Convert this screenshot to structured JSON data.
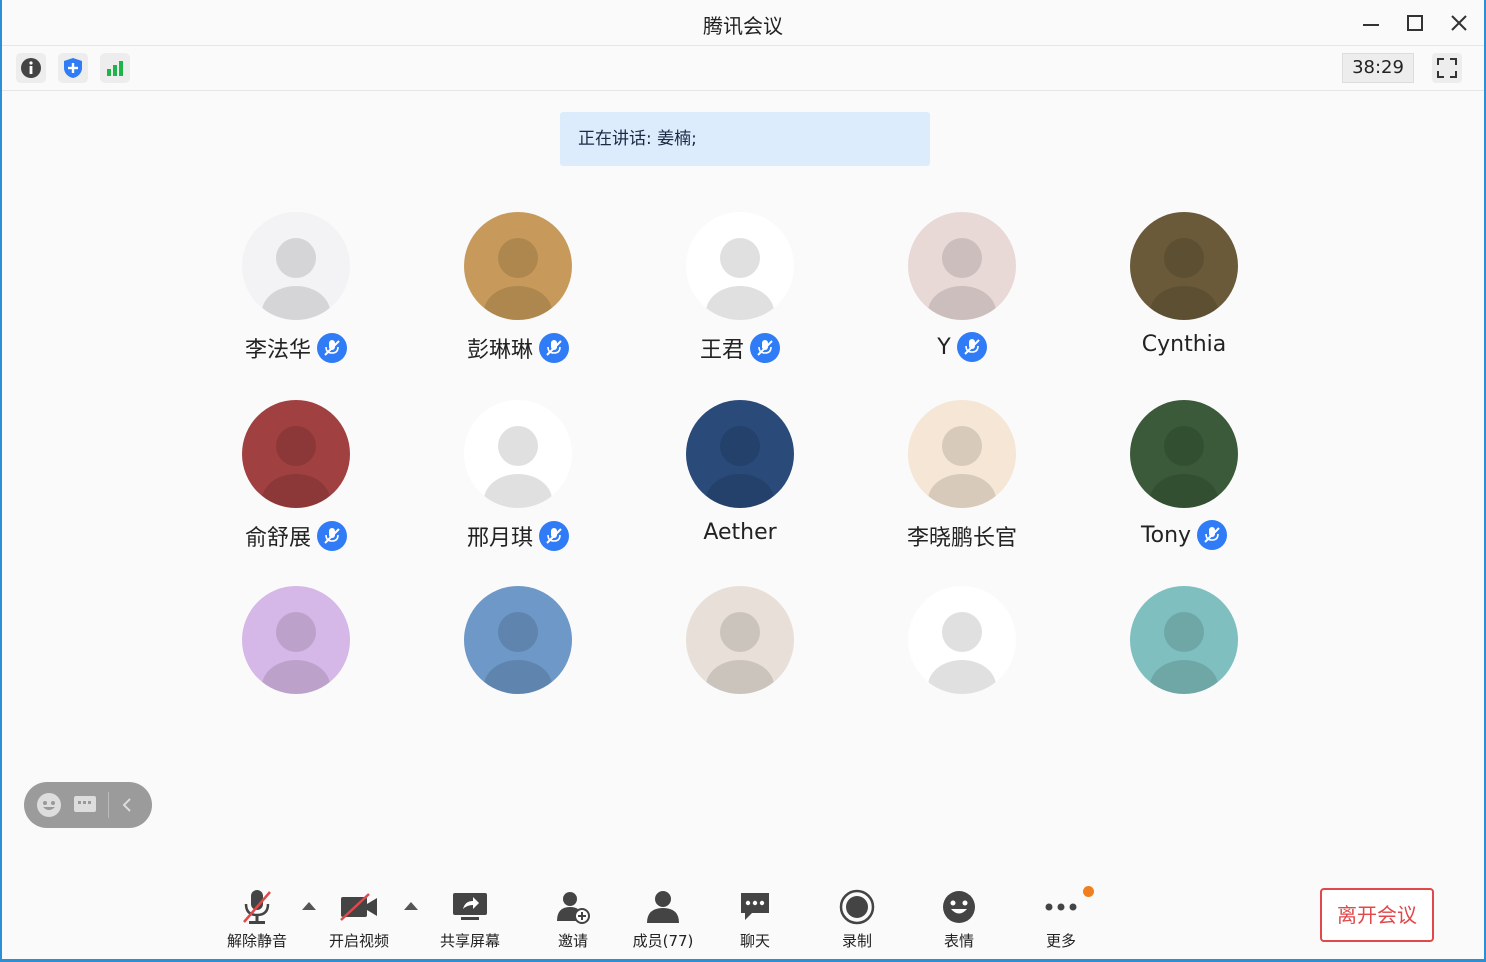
{
  "window": {
    "title": "腾讯会议"
  },
  "toolbar": {
    "timer": "38:29",
    "icons": [
      "info-icon",
      "shield-icon",
      "signal-icon"
    ]
  },
  "speaking": {
    "text": "正在讲话: 姜楠;"
  },
  "participants": [
    {
      "name": "李法华",
      "muted": true,
      "avatar_color": "#f3f3f5"
    },
    {
      "name": "彭琳琳",
      "muted": true,
      "avatar_color": "#c79a5b"
    },
    {
      "name": "王君",
      "muted": true,
      "avatar_color": "#ffffff"
    },
    {
      "name": "Y",
      "muted": true,
      "avatar_color": "#e9d9d6"
    },
    {
      "name": "Cynthia",
      "muted": false,
      "avatar_color": "#6a5a3a"
    },
    {
      "name": "俞舒展",
      "muted": true,
      "avatar_color": "#a04040"
    },
    {
      "name": "邢月琪",
      "muted": true,
      "avatar_color": "#ffffff"
    },
    {
      "name": "Aether",
      "muted": false,
      "avatar_color": "#2a4a7a"
    },
    {
      "name": "李晓鹏长官",
      "muted": false,
      "avatar_color": "#f5e6d5"
    },
    {
      "name": "Tony",
      "muted": true,
      "avatar_color": "#3a5a3a"
    },
    {
      "name": "",
      "muted": false,
      "avatar_color": "#d6b8e8"
    },
    {
      "name": "",
      "muted": false,
      "avatar_color": "#6d98c7"
    },
    {
      "name": "",
      "muted": false,
      "avatar_color": "#e8e0d8"
    },
    {
      "name": "",
      "muted": false,
      "avatar_color": "#ffffff"
    },
    {
      "name": "",
      "muted": false,
      "avatar_color": "#7fbfbf"
    }
  ],
  "bottombar": {
    "unmute": "解除静音",
    "video": "开启视频",
    "share": "共享屏幕",
    "invite": "邀请",
    "members": "成员(77)",
    "chat": "聊天",
    "record": "录制",
    "emoji": "表情",
    "more": "更多",
    "leave": "离开会议"
  },
  "colors": {
    "accent": "#2f7cf6",
    "leave": "#e0484a",
    "notify": "#f07f20",
    "speaking_bg": "#dcecfd"
  }
}
